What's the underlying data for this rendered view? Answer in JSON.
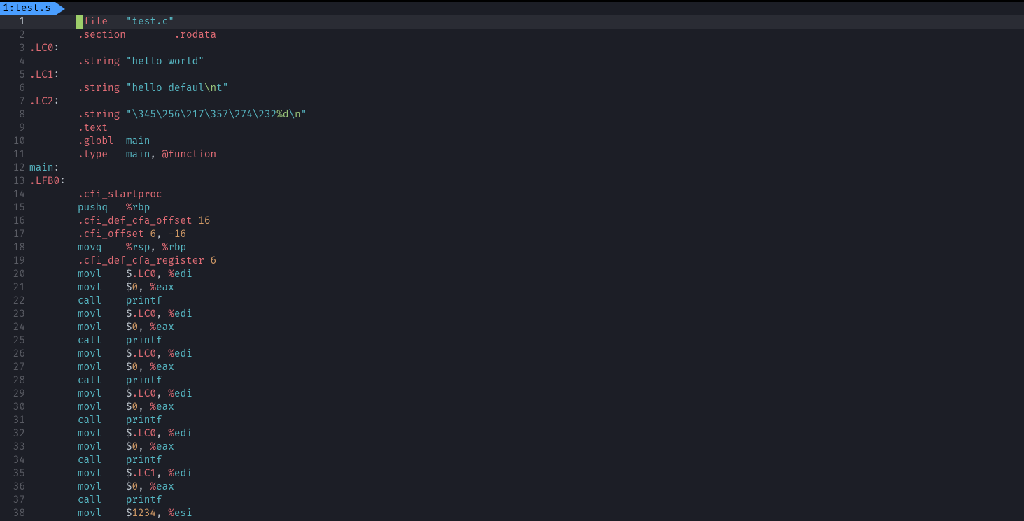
{
  "tab": {
    "index": "1",
    "name": "test.s",
    "sep": ": "
  },
  "cursor": {
    "line": 1,
    "col": 8
  },
  "colors": {
    "accent": "#4a9eff",
    "background": "#1c1e26",
    "gutter": "#5a5c64",
    "currentLine": "#2a2c34",
    "red": "#e06c75",
    "teal": "#56b6c2",
    "orange": "#d19a66",
    "blue": "#61afef",
    "green": "#98c379"
  },
  "lines": [
    {
      "n": 1,
      "hl": true,
      "tokens": [
        [
          "plain",
          "        "
        ],
        [
          "d",
          "."
        ],
        [
          "kw",
          "file"
        ],
        [
          "plain",
          "   "
        ],
        [
          "str",
          "\""
        ],
        [
          "str",
          "test.c"
        ],
        [
          "str",
          "\""
        ]
      ]
    },
    {
      "n": 2,
      "tokens": [
        [
          "plain",
          "        "
        ],
        [
          "d",
          "."
        ],
        [
          "kw",
          "section"
        ],
        [
          "plain",
          "        "
        ],
        [
          "d",
          "."
        ],
        [
          "kw",
          "rodata"
        ]
      ]
    },
    {
      "n": 3,
      "tokens": [
        [
          "d",
          "."
        ],
        [
          "lbl",
          "LC0"
        ],
        [
          "colon",
          ":"
        ]
      ]
    },
    {
      "n": 4,
      "tokens": [
        [
          "plain",
          "        "
        ],
        [
          "d",
          "."
        ],
        [
          "kw",
          "string"
        ],
        [
          "plain",
          " "
        ],
        [
          "str",
          "\"hello world\""
        ]
      ]
    },
    {
      "n": 5,
      "tokens": [
        [
          "d",
          "."
        ],
        [
          "lbl",
          "LC1"
        ],
        [
          "colon",
          ":"
        ]
      ]
    },
    {
      "n": 6,
      "tokens": [
        [
          "plain",
          "        "
        ],
        [
          "d",
          "."
        ],
        [
          "kw",
          "string"
        ],
        [
          "plain",
          " "
        ],
        [
          "str",
          "\"hello defaul"
        ],
        [
          "esc",
          "\\n"
        ],
        [
          "str",
          "t\""
        ]
      ]
    },
    {
      "n": 7,
      "tokens": [
        [
          "d",
          "."
        ],
        [
          "lbl",
          "LC2"
        ],
        [
          "colon",
          ":"
        ]
      ]
    },
    {
      "n": 8,
      "tokens": [
        [
          "plain",
          "        "
        ],
        [
          "d",
          "."
        ],
        [
          "kw",
          "string"
        ],
        [
          "plain",
          " "
        ],
        [
          "str",
          "\"\\345\\256\\217\\357\\274\\232"
        ],
        [
          "esc",
          "%d"
        ],
        [
          "str",
          "\\"
        ],
        [
          "esc",
          "n"
        ],
        [
          "str",
          "\""
        ]
      ]
    },
    {
      "n": 9,
      "tokens": [
        [
          "plain",
          "        "
        ],
        [
          "d",
          "."
        ],
        [
          "kw",
          "text"
        ]
      ]
    },
    {
      "n": 10,
      "tokens": [
        [
          "plain",
          "        "
        ],
        [
          "d",
          "."
        ],
        [
          "kw",
          "globl"
        ],
        [
          "plain",
          "  "
        ],
        [
          "id",
          "main"
        ]
      ]
    },
    {
      "n": 11,
      "tokens": [
        [
          "plain",
          "        "
        ],
        [
          "d",
          "."
        ],
        [
          "kw",
          "type"
        ],
        [
          "plain",
          "   "
        ],
        [
          "id",
          "main"
        ],
        [
          "comma",
          ", "
        ],
        [
          "at",
          "@"
        ],
        [
          "kw",
          "function"
        ]
      ]
    },
    {
      "n": 12,
      "tokens": [
        [
          "id",
          "main"
        ],
        [
          "colon",
          ":"
        ]
      ]
    },
    {
      "n": 13,
      "tokens": [
        [
          "d",
          "."
        ],
        [
          "lbl",
          "LFB0"
        ],
        [
          "colon",
          ":"
        ]
      ]
    },
    {
      "n": 14,
      "tokens": [
        [
          "plain",
          "        "
        ],
        [
          "d",
          "."
        ],
        [
          "kw",
          "cfi_startproc"
        ]
      ]
    },
    {
      "n": 15,
      "tokens": [
        [
          "plain",
          "        "
        ],
        [
          "op",
          "pushq"
        ],
        [
          "plain",
          "   "
        ],
        [
          "pct",
          "%"
        ],
        [
          "reg",
          "rbp"
        ]
      ]
    },
    {
      "n": 16,
      "tokens": [
        [
          "plain",
          "        "
        ],
        [
          "d",
          "."
        ],
        [
          "kw",
          "cfi_def_cfa_offset"
        ],
        [
          "plain",
          " "
        ],
        [
          "num",
          "16"
        ]
      ]
    },
    {
      "n": 17,
      "tokens": [
        [
          "plain",
          "        "
        ],
        [
          "d",
          "."
        ],
        [
          "kw",
          "cfi_offset"
        ],
        [
          "plain",
          " "
        ],
        [
          "num",
          "6"
        ],
        [
          "comma",
          ", "
        ],
        [
          "num",
          "-16"
        ]
      ]
    },
    {
      "n": 18,
      "tokens": [
        [
          "plain",
          "        "
        ],
        [
          "op",
          "movq"
        ],
        [
          "plain",
          "    "
        ],
        [
          "pct",
          "%"
        ],
        [
          "reg",
          "rsp"
        ],
        [
          "comma",
          ", "
        ],
        [
          "pct",
          "%"
        ],
        [
          "reg",
          "rbp"
        ]
      ]
    },
    {
      "n": 19,
      "tokens": [
        [
          "plain",
          "        "
        ],
        [
          "d",
          "."
        ],
        [
          "kw",
          "cfi_def_cfa_register"
        ],
        [
          "plain",
          " "
        ],
        [
          "num",
          "6"
        ]
      ]
    },
    {
      "n": 20,
      "tokens": [
        [
          "plain",
          "        "
        ],
        [
          "op",
          "movl"
        ],
        [
          "plain",
          "    "
        ],
        [
          "dollar",
          "$"
        ],
        [
          "d",
          "."
        ],
        [
          "lbl",
          "LC0"
        ],
        [
          "comma",
          ", "
        ],
        [
          "pct",
          "%"
        ],
        [
          "reg",
          "edi"
        ]
      ]
    },
    {
      "n": 21,
      "tokens": [
        [
          "plain",
          "        "
        ],
        [
          "op",
          "movl"
        ],
        [
          "plain",
          "    "
        ],
        [
          "dollar",
          "$"
        ],
        [
          "num",
          "0"
        ],
        [
          "comma",
          ", "
        ],
        [
          "pct",
          "%"
        ],
        [
          "reg",
          "eax"
        ]
      ]
    },
    {
      "n": 22,
      "tokens": [
        [
          "plain",
          "        "
        ],
        [
          "op",
          "call"
        ],
        [
          "plain",
          "    "
        ],
        [
          "id",
          "printf"
        ]
      ]
    },
    {
      "n": 23,
      "tokens": [
        [
          "plain",
          "        "
        ],
        [
          "op",
          "movl"
        ],
        [
          "plain",
          "    "
        ],
        [
          "dollar",
          "$"
        ],
        [
          "d",
          "."
        ],
        [
          "lbl",
          "LC0"
        ],
        [
          "comma",
          ", "
        ],
        [
          "pct",
          "%"
        ],
        [
          "reg",
          "edi"
        ]
      ]
    },
    {
      "n": 24,
      "tokens": [
        [
          "plain",
          "        "
        ],
        [
          "op",
          "movl"
        ],
        [
          "plain",
          "    "
        ],
        [
          "dollar",
          "$"
        ],
        [
          "num",
          "0"
        ],
        [
          "comma",
          ", "
        ],
        [
          "pct",
          "%"
        ],
        [
          "reg",
          "eax"
        ]
      ]
    },
    {
      "n": 25,
      "tokens": [
        [
          "plain",
          "        "
        ],
        [
          "op",
          "call"
        ],
        [
          "plain",
          "    "
        ],
        [
          "id",
          "printf"
        ]
      ]
    },
    {
      "n": 26,
      "tokens": [
        [
          "plain",
          "        "
        ],
        [
          "op",
          "movl"
        ],
        [
          "plain",
          "    "
        ],
        [
          "dollar",
          "$"
        ],
        [
          "d",
          "."
        ],
        [
          "lbl",
          "LC0"
        ],
        [
          "comma",
          ", "
        ],
        [
          "pct",
          "%"
        ],
        [
          "reg",
          "edi"
        ]
      ]
    },
    {
      "n": 27,
      "tokens": [
        [
          "plain",
          "        "
        ],
        [
          "op",
          "movl"
        ],
        [
          "plain",
          "    "
        ],
        [
          "dollar",
          "$"
        ],
        [
          "num",
          "0"
        ],
        [
          "comma",
          ", "
        ],
        [
          "pct",
          "%"
        ],
        [
          "reg",
          "eax"
        ]
      ]
    },
    {
      "n": 28,
      "tokens": [
        [
          "plain",
          "        "
        ],
        [
          "op",
          "call"
        ],
        [
          "plain",
          "    "
        ],
        [
          "id",
          "printf"
        ]
      ]
    },
    {
      "n": 29,
      "tokens": [
        [
          "plain",
          "        "
        ],
        [
          "op",
          "movl"
        ],
        [
          "plain",
          "    "
        ],
        [
          "dollar",
          "$"
        ],
        [
          "d",
          "."
        ],
        [
          "lbl",
          "LC0"
        ],
        [
          "comma",
          ", "
        ],
        [
          "pct",
          "%"
        ],
        [
          "reg",
          "edi"
        ]
      ]
    },
    {
      "n": 30,
      "tokens": [
        [
          "plain",
          "        "
        ],
        [
          "op",
          "movl"
        ],
        [
          "plain",
          "    "
        ],
        [
          "dollar",
          "$"
        ],
        [
          "num",
          "0"
        ],
        [
          "comma",
          ", "
        ],
        [
          "pct",
          "%"
        ],
        [
          "reg",
          "eax"
        ]
      ]
    },
    {
      "n": 31,
      "tokens": [
        [
          "plain",
          "        "
        ],
        [
          "op",
          "call"
        ],
        [
          "plain",
          "    "
        ],
        [
          "id",
          "printf"
        ]
      ]
    },
    {
      "n": 32,
      "tokens": [
        [
          "plain",
          "        "
        ],
        [
          "op",
          "movl"
        ],
        [
          "plain",
          "    "
        ],
        [
          "dollar",
          "$"
        ],
        [
          "d",
          "."
        ],
        [
          "lbl",
          "LC0"
        ],
        [
          "comma",
          ", "
        ],
        [
          "pct",
          "%"
        ],
        [
          "reg",
          "edi"
        ]
      ]
    },
    {
      "n": 33,
      "tokens": [
        [
          "plain",
          "        "
        ],
        [
          "op",
          "movl"
        ],
        [
          "plain",
          "    "
        ],
        [
          "dollar",
          "$"
        ],
        [
          "num",
          "0"
        ],
        [
          "comma",
          ", "
        ],
        [
          "pct",
          "%"
        ],
        [
          "reg",
          "eax"
        ]
      ]
    },
    {
      "n": 34,
      "tokens": [
        [
          "plain",
          "        "
        ],
        [
          "op",
          "call"
        ],
        [
          "plain",
          "    "
        ],
        [
          "id",
          "printf"
        ]
      ]
    },
    {
      "n": 35,
      "tokens": [
        [
          "plain",
          "        "
        ],
        [
          "op",
          "movl"
        ],
        [
          "plain",
          "    "
        ],
        [
          "dollar",
          "$"
        ],
        [
          "d",
          "."
        ],
        [
          "lbl",
          "LC1"
        ],
        [
          "comma",
          ", "
        ],
        [
          "pct",
          "%"
        ],
        [
          "reg",
          "edi"
        ]
      ]
    },
    {
      "n": 36,
      "tokens": [
        [
          "plain",
          "        "
        ],
        [
          "op",
          "movl"
        ],
        [
          "plain",
          "    "
        ],
        [
          "dollar",
          "$"
        ],
        [
          "num",
          "0"
        ],
        [
          "comma",
          ", "
        ],
        [
          "pct",
          "%"
        ],
        [
          "reg",
          "eax"
        ]
      ]
    },
    {
      "n": 37,
      "tokens": [
        [
          "plain",
          "        "
        ],
        [
          "op",
          "call"
        ],
        [
          "plain",
          "    "
        ],
        [
          "id",
          "printf"
        ]
      ]
    },
    {
      "n": 38,
      "tokens": [
        [
          "plain",
          "        "
        ],
        [
          "op",
          "movl"
        ],
        [
          "plain",
          "    "
        ],
        [
          "dollar",
          "$"
        ],
        [
          "num",
          "1234"
        ],
        [
          "comma",
          ", "
        ],
        [
          "pct",
          "%"
        ],
        [
          "reg",
          "esi"
        ]
      ]
    }
  ]
}
